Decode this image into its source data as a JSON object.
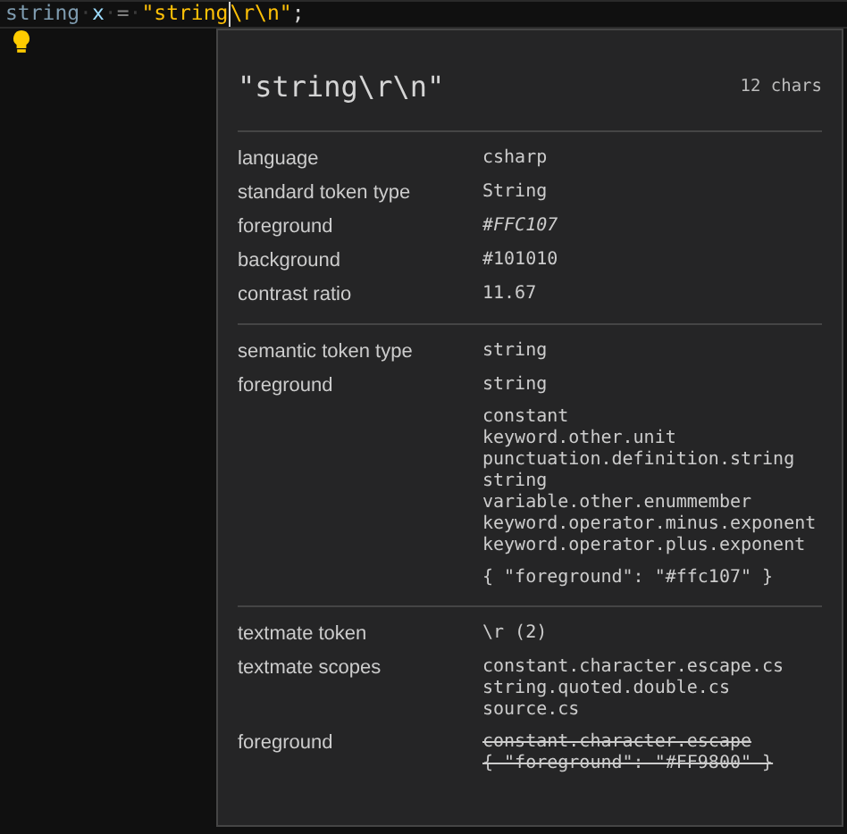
{
  "editor": {
    "tokens": [
      {
        "text": "string",
        "kind": "type"
      },
      {
        "text": "·",
        "kind": "whitespace"
      },
      {
        "text": "x",
        "kind": "identifier"
      },
      {
        "text": "·",
        "kind": "whitespace"
      },
      {
        "text": "=",
        "kind": "operator"
      },
      {
        "text": "·",
        "kind": "whitespace"
      },
      {
        "text": "\"string",
        "kind": "string"
      },
      {
        "kind": "cursor"
      },
      {
        "text": "\\r\\n\"",
        "kind": "string"
      },
      {
        "text": ";",
        "kind": "punctuation"
      }
    ]
  },
  "inspector": {
    "title": "\"string\\r\\n\"",
    "length": "12 chars",
    "sections": [
      {
        "rows": [
          {
            "label": "language",
            "blocks": [
              [
                "csharp"
              ]
            ],
            "italic": false,
            "struck": false
          },
          {
            "label": "standard token type",
            "blocks": [
              [
                "String"
              ]
            ],
            "italic": false,
            "struck": false
          },
          {
            "label": "foreground",
            "blocks": [
              [
                "#FFC107"
              ]
            ],
            "italic": true,
            "struck": false
          },
          {
            "label": "background",
            "blocks": [
              [
                "#101010"
              ]
            ],
            "italic": false,
            "struck": false
          },
          {
            "label": "contrast ratio",
            "blocks": [
              [
                "11.67"
              ]
            ],
            "italic": false,
            "struck": false
          }
        ]
      },
      {
        "rows": [
          {
            "label": "semantic token type",
            "blocks": [
              [
                "string"
              ]
            ],
            "italic": false,
            "struck": false
          },
          {
            "label": "foreground",
            "blocks": [
              [
                "string"
              ],
              [
                "constant",
                "keyword.other.unit",
                "punctuation.definition.string",
                "string",
                "variable.other.enummember",
                "keyword.operator.minus.exponent",
                "keyword.operator.plus.exponent"
              ],
              [
                "{ \"foreground\": \"#ffc107\" }"
              ]
            ],
            "italic": false,
            "struck": false
          }
        ]
      },
      {
        "rows": [
          {
            "label": "textmate token",
            "blocks": [
              [
                "\\r (2)"
              ]
            ],
            "italic": false,
            "struck": false
          },
          {
            "label": "textmate scopes",
            "blocks": [
              [
                "constant.character.escape.cs",
                "string.quoted.double.cs",
                "source.cs"
              ]
            ],
            "italic": false,
            "struck": false
          },
          {
            "label": "foreground",
            "blocks": [
              [
                "constant.character.escape",
                "{ \"foreground\": \"#FF9800\" }"
              ]
            ],
            "italic": false,
            "struck": true
          }
        ]
      }
    ]
  }
}
